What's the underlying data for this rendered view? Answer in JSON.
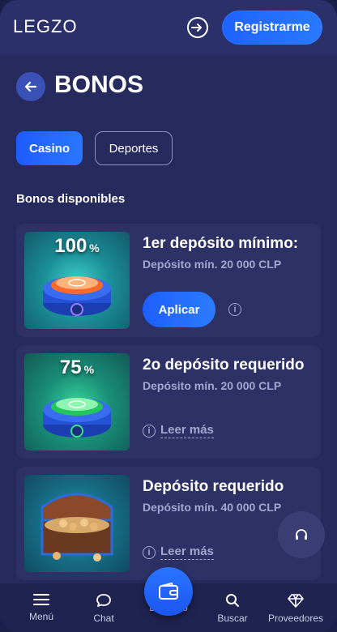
{
  "header": {
    "logo": "LEGZO",
    "register_label": "Registrarme"
  },
  "page": {
    "title": "BONOS"
  },
  "tabs": [
    {
      "label": "Casino",
      "active": true
    },
    {
      "label": "Deportes",
      "active": false
    }
  ],
  "section_label": "Bonos disponibles",
  "bonuses": [
    {
      "percent": "100",
      "percent_symbol": "%",
      "title": "1er depósito mínimo:",
      "subtitle": "Depósito mín. 20 000 CLP",
      "action": "Aplicar"
    },
    {
      "percent": "75",
      "percent_symbol": "%",
      "title": "2o depósito requerido",
      "subtitle": "Depósito mín. 20 000 CLP",
      "action": "Leer más"
    },
    {
      "percent": "",
      "percent_symbol": "",
      "title": "Depósito requerido",
      "subtitle": "Depósito mín. 40 000 CLP",
      "action": "Leer más"
    }
  ],
  "info_glyph": "i",
  "bottom_nav": [
    {
      "label": "Menú",
      "icon": "menu-icon"
    },
    {
      "label": "Chat",
      "icon": "chat-icon"
    },
    {
      "label": "Depósito",
      "icon": "wallet-icon"
    },
    {
      "label": "Buscar",
      "icon": "search-icon"
    },
    {
      "label": "Proveedores",
      "icon": "diamond-icon"
    }
  ],
  "colors": {
    "accent": "#2a6dff",
    "background": "#262a5c",
    "card": "#2d3166",
    "muted_text": "#a3a7cf"
  }
}
